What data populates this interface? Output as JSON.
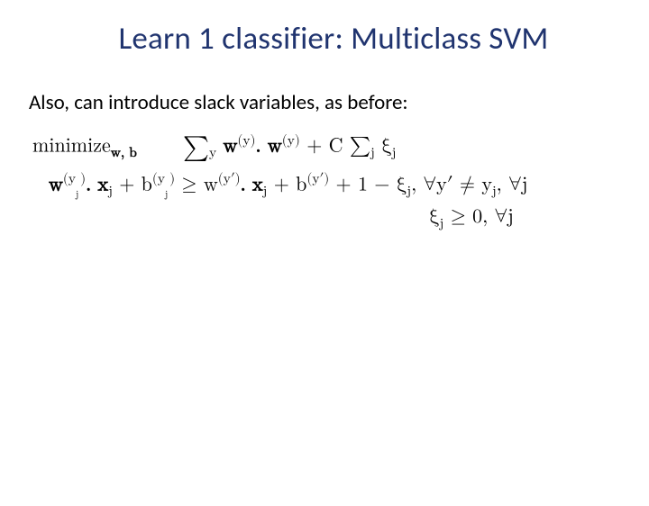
{
  "title": "Learn 1 classifier: Multiclass SVM",
  "subtext": "Also, can introduce slack variables, as before:",
  "math": {
    "l1_a": "minimize",
    "l1_sub": "w, b",
    "l1_b": "∑",
    "l1_b_sub": "y",
    "l1_c": " w",
    "l1_c_sup": "(y)",
    "l1_d": ". w",
    "l1_d_sup": "(y)",
    "l1_e": " + C ∑",
    "l1_e_sub": "j",
    "l1_f": " ξ",
    "l1_f_sub": "j",
    "l2_a": "w",
    "l2_a_sup": "(y",
    "l2_a_sup2": "j",
    "l2_a_sup3": ")",
    "l2_b": ". x",
    "l2_b_sub": "j",
    "l2_c": " + b",
    "l2_c_sup": "(y",
    "l2_c_sup2": "j",
    "l2_c_sup3": ")",
    "l2_d": " ≥ w",
    "l2_d_sup": "(y′)",
    "l2_e": ". x",
    "l2_e_sub": "j",
    "l2_f": " + b",
    "l2_f_sup": "(y′)",
    "l2_g": " + 1 − ξ",
    "l2_g_sub": "j",
    "l2_h": ",  ∀y′ ≠ y",
    "l2_h_sub": "j",
    "l2_i": ",  ∀j",
    "l3_a": "ξ",
    "l3_a_sub": "j",
    "l3_b": " ≥ 0,  ∀j"
  }
}
